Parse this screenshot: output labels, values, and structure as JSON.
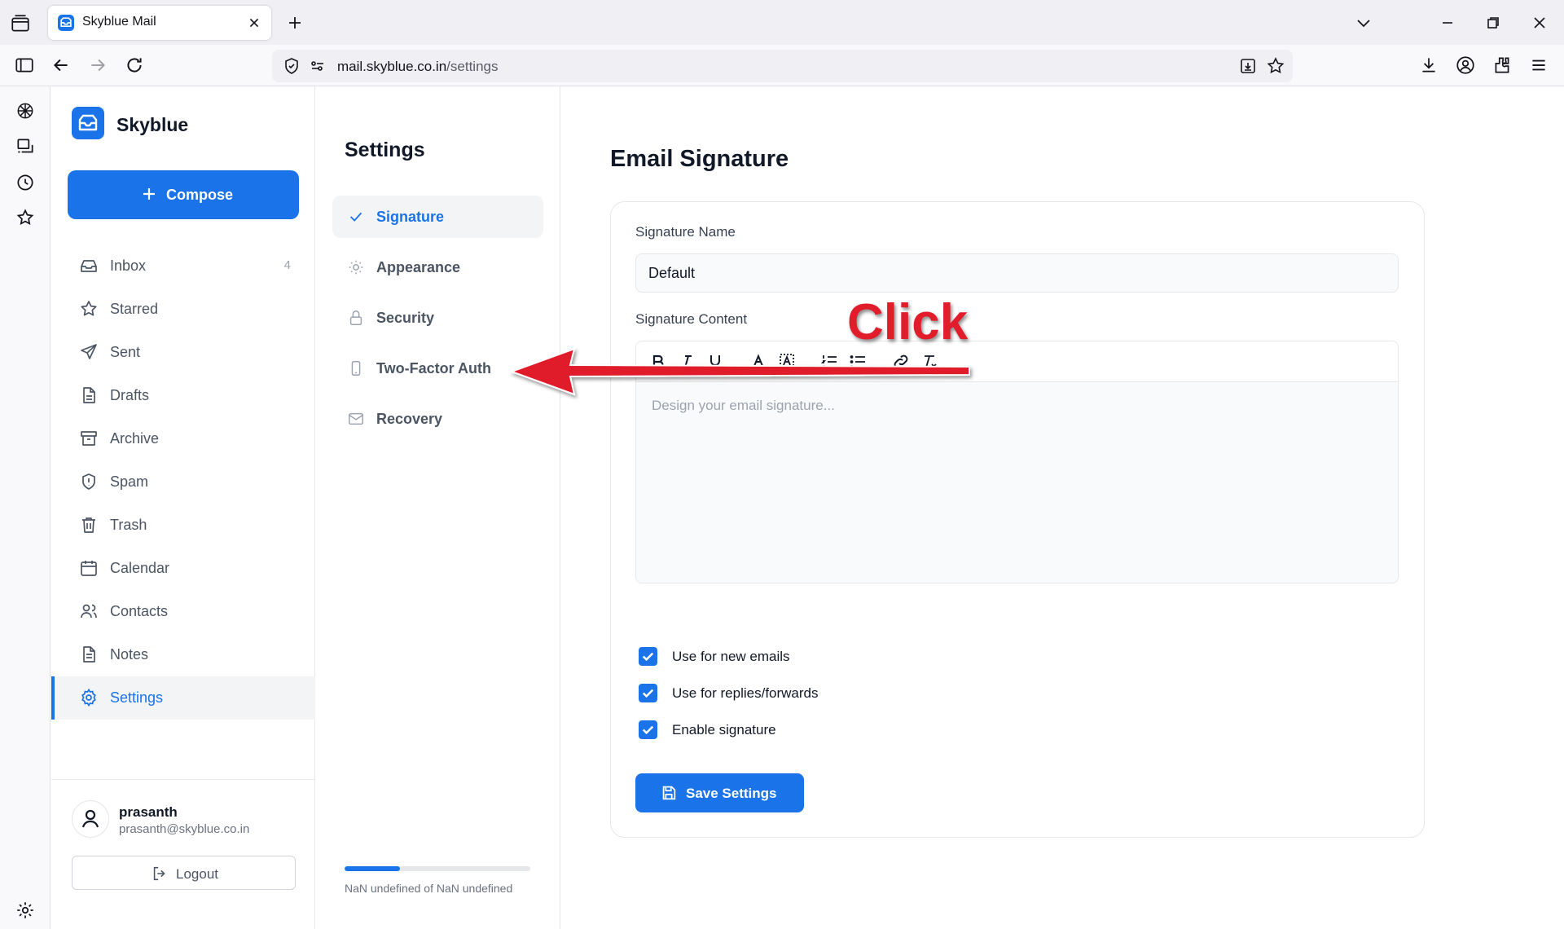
{
  "browser": {
    "tab_title": "Skyblue Mail",
    "url_host": "mail.skyblue.co.in",
    "url_path": "/settings"
  },
  "app": {
    "brand": "Skyblue",
    "compose_label": "Compose",
    "nav": [
      {
        "label": "Inbox",
        "icon": "inbox-icon",
        "count": "4"
      },
      {
        "label": "Starred",
        "icon": "star-icon"
      },
      {
        "label": "Sent",
        "icon": "send-icon"
      },
      {
        "label": "Drafts",
        "icon": "drafts-icon"
      },
      {
        "label": "Archive",
        "icon": "archive-icon"
      },
      {
        "label": "Spam",
        "icon": "shield-icon"
      },
      {
        "label": "Trash",
        "icon": "trash-icon"
      },
      {
        "label": "Calendar",
        "icon": "calendar-icon"
      },
      {
        "label": "Contacts",
        "icon": "contacts-icon"
      },
      {
        "label": "Notes",
        "icon": "notes-icon"
      },
      {
        "label": "Settings",
        "icon": "gear-icon",
        "active": true
      }
    ],
    "user": {
      "name": "prasanth",
      "email": "prasanth@skyblue.co.in"
    },
    "logout_label": "Logout"
  },
  "settings": {
    "title": "Settings",
    "items": [
      {
        "label": "Signature",
        "icon": "check-icon",
        "active": true
      },
      {
        "label": "Appearance",
        "icon": "sun-icon"
      },
      {
        "label": "Security",
        "icon": "lock-icon"
      },
      {
        "label": "Two-Factor Auth",
        "icon": "phone-icon"
      },
      {
        "label": "Recovery",
        "icon": "mail-icon"
      }
    ],
    "storage_text": "NaN undefined of NaN undefined",
    "storage_fraction": 0.3
  },
  "signature": {
    "title": "Email Signature",
    "name_label": "Signature Name",
    "name_value": "Default",
    "content_label": "Signature Content",
    "content_placeholder": "Design your email signature...",
    "options": [
      {
        "label": "Use for new emails",
        "checked": true
      },
      {
        "label": "Use for replies/forwards",
        "checked": true
      },
      {
        "label": "Enable signature",
        "checked": true
      }
    ],
    "save_label": "Save Settings"
  },
  "annotation": {
    "text": "Click",
    "color": "#e11d2b"
  },
  "colors": {
    "accent": "#1a73e8"
  }
}
